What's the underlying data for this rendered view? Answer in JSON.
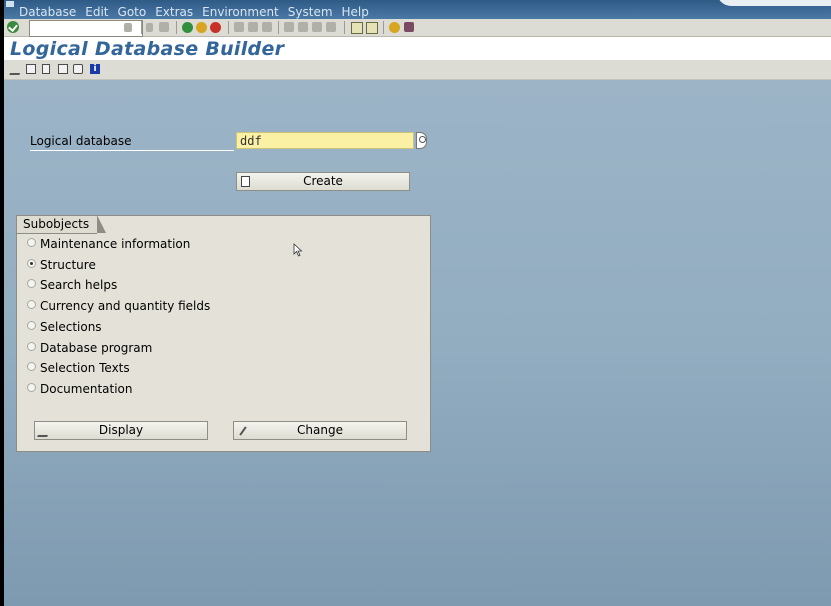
{
  "menu": {
    "items": [
      "Database",
      "Edit",
      "Goto",
      "Extras",
      "Environment",
      "System",
      "Help"
    ]
  },
  "toolbar": {
    "command_value": "",
    "icons": [
      "ok-icon",
      "save-icon",
      "back-icon",
      "exit-icon",
      "cancel-icon",
      "print-icon",
      "find-icon",
      "find-next-icon",
      "first-page-icon",
      "prev-page-icon",
      "next-page-icon",
      "last-page-icon",
      "new-session-icon",
      "shortcut-icon",
      "help-icon",
      "layout-icon"
    ]
  },
  "page": {
    "title": "Logical Database Builder"
  },
  "app_toolbar": {
    "icons": [
      "display-change-icon",
      "copy-icon",
      "delete-icon",
      "rename-icon",
      "where-used-icon",
      "info-icon"
    ]
  },
  "form": {
    "logical_database_label": "Logical database",
    "logical_database_value": "ddf",
    "create_label": "Create"
  },
  "subobjects": {
    "title": "Subobjects",
    "options": [
      {
        "label": "Maintenance information",
        "checked": false
      },
      {
        "label": "Structure",
        "checked": true
      },
      {
        "label": "Search helps",
        "checked": false
      },
      {
        "label": "Currency and quantity fields",
        "checked": false
      },
      {
        "label": "Selections",
        "checked": false
      },
      {
        "label": "Database program",
        "checked": false
      },
      {
        "label": "Selection Texts",
        "checked": false
      },
      {
        "label": "Documentation",
        "checked": false
      }
    ],
    "display_label": "Display",
    "change_label": "Change"
  },
  "colors": {
    "title": "#33669a",
    "background": "#93adc1",
    "input_required": "#fbf1a4"
  }
}
